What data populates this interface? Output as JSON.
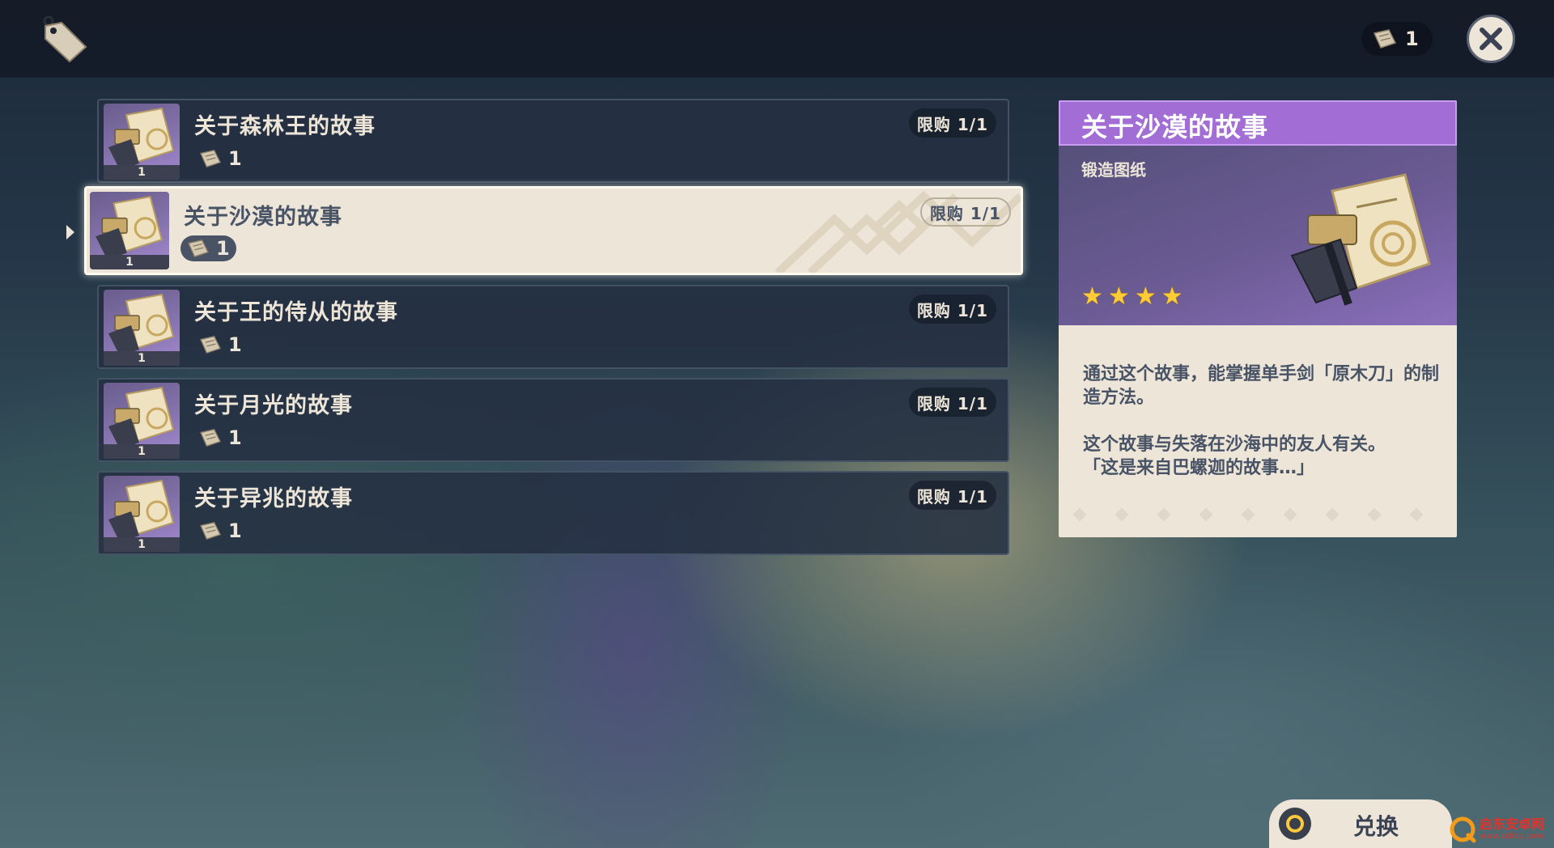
{
  "header": {
    "currency_count": "1"
  },
  "items": [
    {
      "name": "关于森林王的故事",
      "cost": "1",
      "limit": "限购 1/1",
      "thumb_count": "1"
    },
    {
      "name": "关于沙漠的故事",
      "cost": "1",
      "limit": "限购 1/1",
      "thumb_count": "1"
    },
    {
      "name": "关于王的侍从的故事",
      "cost": "1",
      "limit": "限购 1/1",
      "thumb_count": "1"
    },
    {
      "name": "关于月光的故事",
      "cost": "1",
      "limit": "限购 1/1",
      "thumb_count": "1"
    },
    {
      "name": "关于异兆的故事",
      "cost": "1",
      "limit": "限购 1/1",
      "thumb_count": "1"
    }
  ],
  "selected_index": 1,
  "detail": {
    "title": "关于沙漠的故事",
    "type": "锻造图纸",
    "stars": [
      "★",
      "★",
      "★",
      "★"
    ],
    "rarity": 4,
    "desc1": "通过这个故事，能掌握单手剑「原木刀」的制造方法。",
    "desc2": "这个故事与失落在沙海中的友人有关。\n「这是来自巴螺迦的故事…」"
  },
  "exchange_label": "兑换",
  "watermark": {
    "name": "启东安卓网",
    "url": "www.qdldq.com"
  },
  "colors": {
    "rarity_purple": "#a26ed6",
    "parchment": "#ece5d8",
    "text_dark": "#495366",
    "star_gold": "#ffcc33"
  }
}
